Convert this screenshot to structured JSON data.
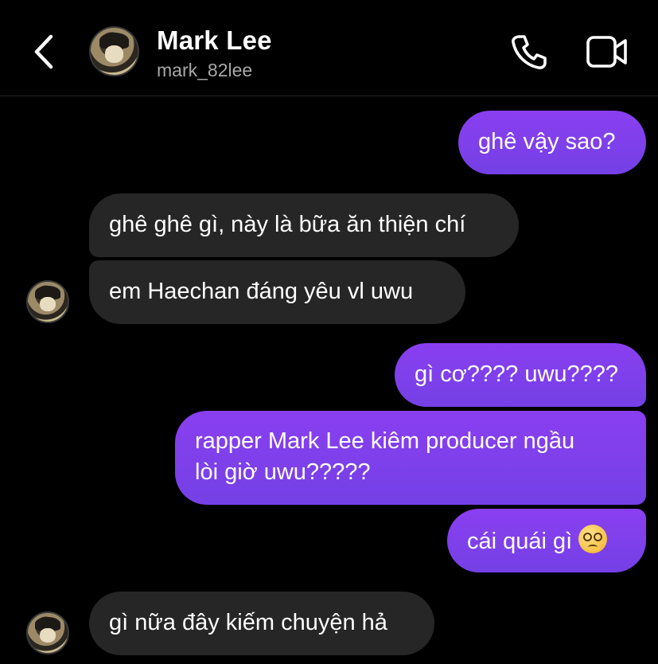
{
  "header": {
    "name": "Mark Lee",
    "username": "mark_82lee",
    "back_icon": "chevron-left-icon",
    "call_icon": "phone-icon",
    "video_icon": "video-camera-icon"
  },
  "colors": {
    "background": "#000000",
    "incoming_bubble": "#262626",
    "outgoing_bubble": "#7c3fe9"
  },
  "messages": [
    {
      "direction": "outgoing",
      "text": "ghê vậy sao?"
    },
    {
      "direction": "incoming",
      "text": "ghê ghê gì, này là bữa ăn thiện chí"
    },
    {
      "direction": "incoming",
      "text": "em Haechan đáng yêu vl uwu"
    },
    {
      "direction": "outgoing",
      "text": "gì cơ???? uwu????"
    },
    {
      "direction": "outgoing",
      "line1": "rapper Mark Lee kiêm producer ngầu",
      "line2": "lòi giờ uwu?????"
    },
    {
      "direction": "outgoing",
      "text": "cái quái gì",
      "emoji": "dizzy-face-emoji"
    },
    {
      "direction": "incoming",
      "text": "gì nữa đây kiếm chuyện hả"
    }
  ]
}
